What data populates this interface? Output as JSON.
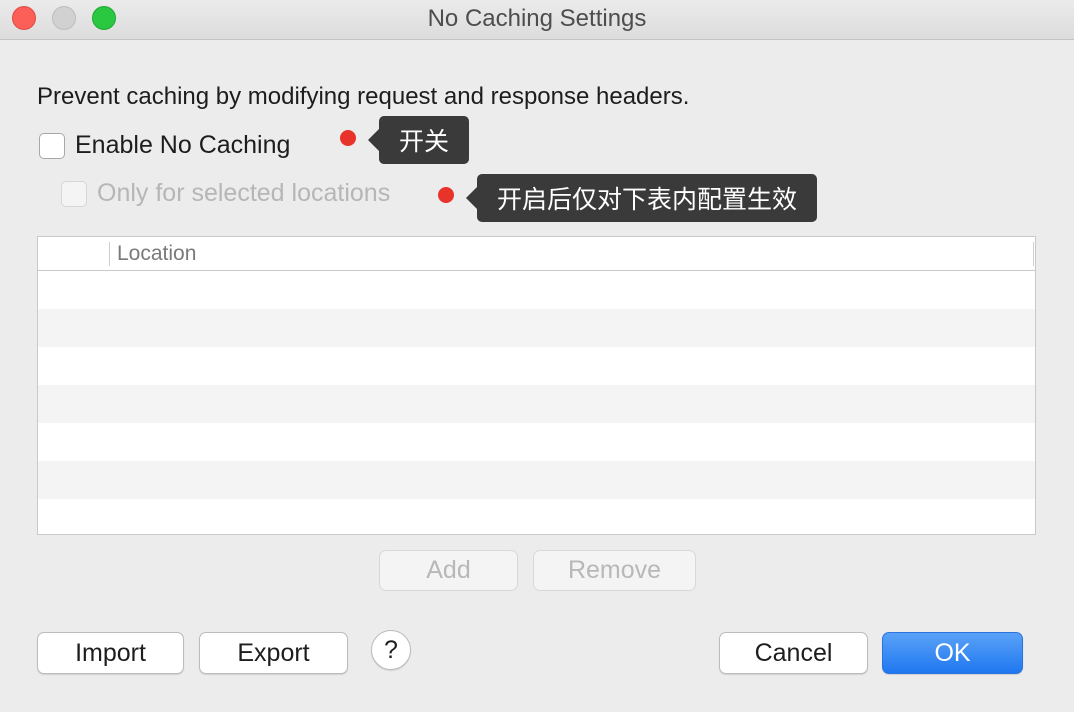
{
  "window": {
    "title": "No Caching Settings"
  },
  "description": "Prevent caching by modifying request and response headers.",
  "enable_checkbox": {
    "label": "Enable No Caching",
    "checked": false
  },
  "selected_locations_checkbox": {
    "label": "Only for selected locations",
    "checked": false,
    "disabled": true
  },
  "annotations": {
    "enable_tip": "开关",
    "locations_tip": "开启后仅对下表内配置生效",
    "dot_color": "#e8332a"
  },
  "table": {
    "columns": [
      "Location"
    ],
    "rows": []
  },
  "buttons": {
    "add": "Add",
    "remove": "Remove",
    "import": "Import",
    "export": "Export",
    "help": "?",
    "cancel": "Cancel",
    "ok": "OK"
  },
  "colors": {
    "accent": "#1f77f0",
    "traffic_close": "#fc5f57",
    "traffic_min": "#d1d1d1",
    "traffic_max": "#2ac840"
  }
}
